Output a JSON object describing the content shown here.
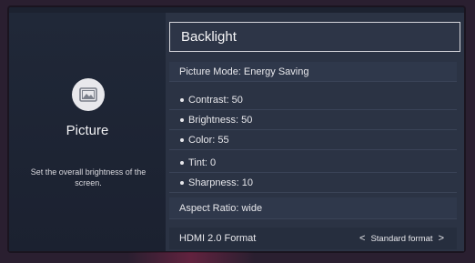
{
  "left_panel": {
    "category_title": "Picture",
    "description": "Set the overall brightness of the screen."
  },
  "header": {
    "title": "Backlight"
  },
  "picture_mode": "Picture Mode: Energy Saving",
  "settings": [
    {
      "label": "Contrast: 50"
    },
    {
      "label": "Brightness: 50"
    },
    {
      "label": "Color: 55"
    },
    {
      "label": "Tint: 0"
    },
    {
      "label": "Sharpness: 10"
    }
  ],
  "aspect_ratio": "Aspect Ratio: wide",
  "hdmi": {
    "label": "HDMI 2.0 Format",
    "value": "Standard format",
    "left_arrow": "<",
    "right_arrow": ">"
  },
  "icons": {
    "category": "picture-icon"
  },
  "colors": {
    "panel": "#2b3344",
    "highlight_border": "#d6d6dc",
    "text": "#e8e8ec"
  }
}
